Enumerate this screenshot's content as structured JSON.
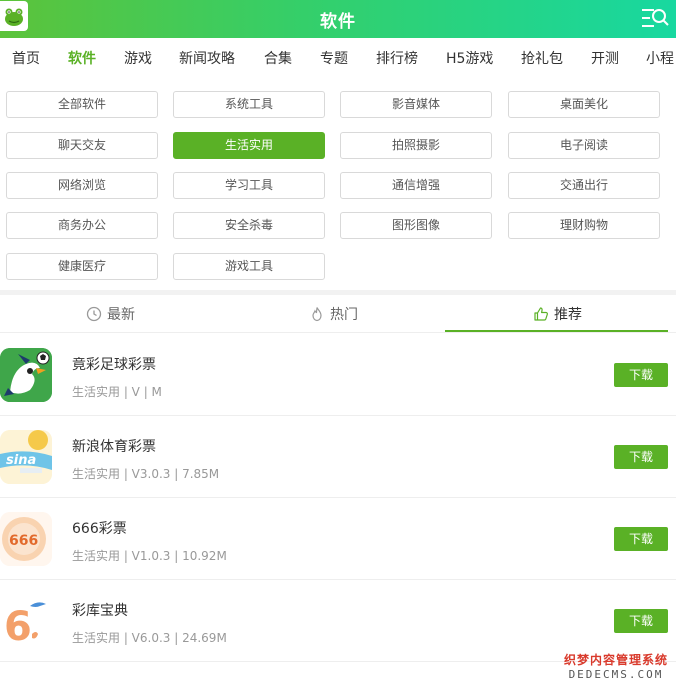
{
  "header": {
    "title": "软件"
  },
  "nav": {
    "items": [
      "首页",
      "软件",
      "游戏",
      "新闻攻略",
      "合集",
      "专题",
      "排行榜",
      "H5游戏",
      "抢礼包",
      "开测",
      "小程"
    ],
    "active_index": 1
  },
  "categories": [
    "全部软件",
    "系统工具",
    "影音媒体",
    "桌面美化",
    "聊天交友",
    "生活实用",
    "拍照摄影",
    "电子阅读",
    "网络浏览",
    "学习工具",
    "通信增强",
    "交通出行",
    "商务办公",
    "安全杀毒",
    "图形图像",
    "理财购物",
    "健康医疗",
    "游戏工具"
  ],
  "active_category": "生活实用",
  "tabs": [
    {
      "label": "最新",
      "icon": "clock-icon"
    },
    {
      "label": "热门",
      "icon": "flame-icon"
    },
    {
      "label": "推荐",
      "icon": "thumbs-up-icon"
    }
  ],
  "active_tab": 2,
  "apps": [
    {
      "name": "竟彩足球彩票",
      "meta": "生活实用 | V | M",
      "icon": "soccer-bird-icon",
      "button": "下载"
    },
    {
      "name": "新浪体育彩票",
      "meta": "生活实用 | V3.0.3 | 7.85M",
      "icon": "sina-icon",
      "button": "下载"
    },
    {
      "name": "666彩票",
      "meta": "生活实用 | V1.0.3 | 10.92M",
      "icon": "lottery-666-icon",
      "button": "下载"
    },
    {
      "name": "彩库宝典",
      "meta": "生活实用 | V6.0.3 | 24.69M",
      "icon": "caiku-icon",
      "button": "下载"
    }
  ],
  "watermark": {
    "line1": "织梦内容管理系统",
    "line2": "DEDECMS.COM"
  },
  "colors": {
    "accent": "#5ab126",
    "header_start": "#5cc33a",
    "header_end": "#18d8a0"
  }
}
